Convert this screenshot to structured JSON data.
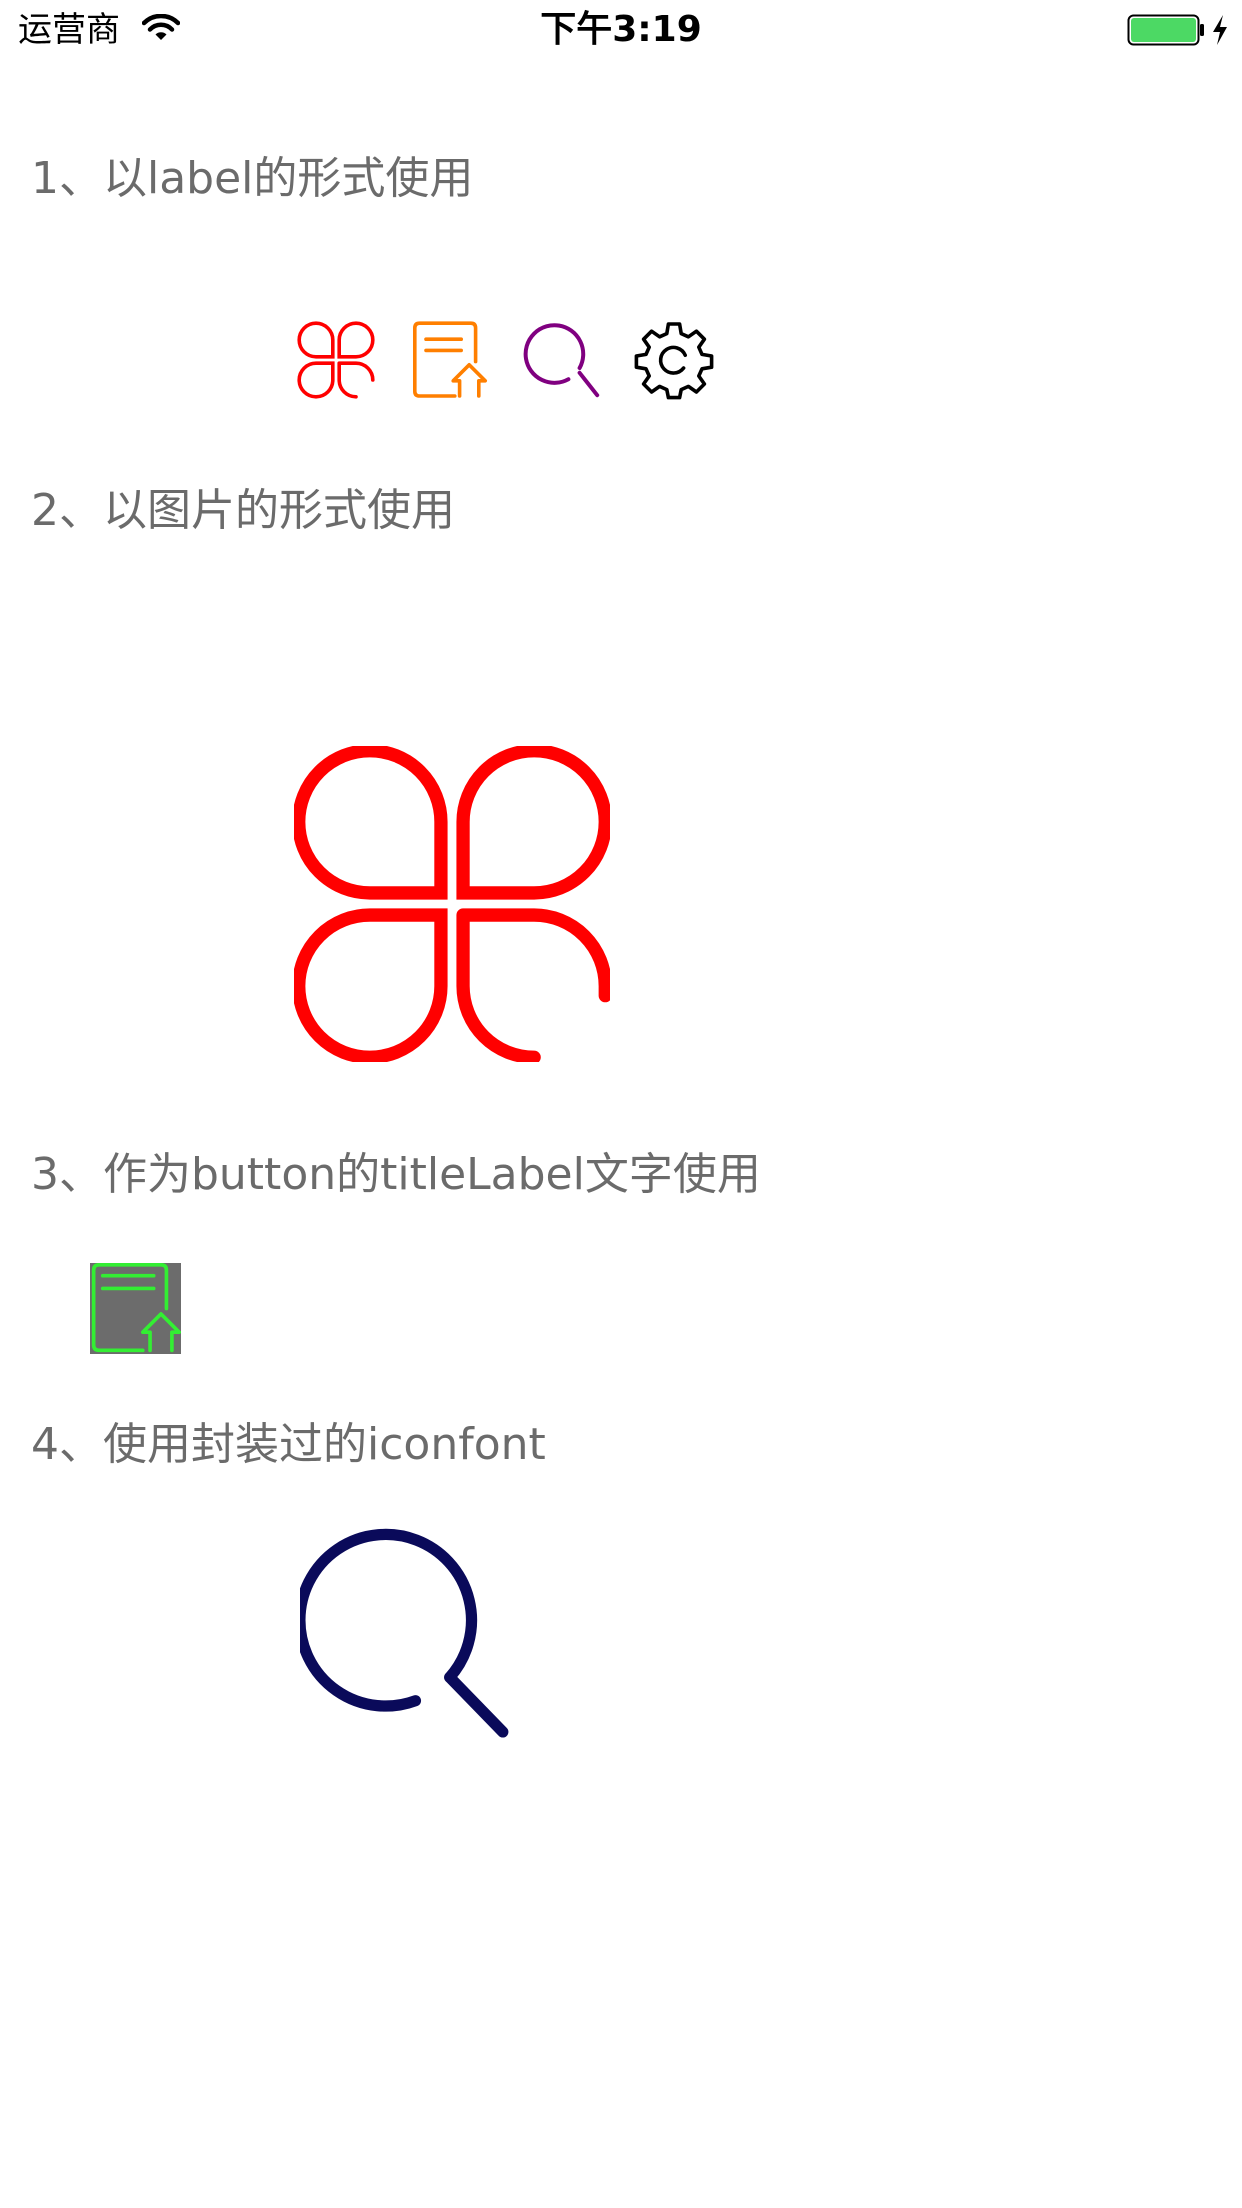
{
  "status_bar": {
    "carrier": "运营商",
    "time": "下午3:19",
    "wifi_icon": "wifi-icon",
    "battery_icon": "battery-icon",
    "charging_icon": "bolt-icon",
    "battery_color": "#4cd964"
  },
  "sections": {
    "label": {
      "title": "1、以label的形式使用",
      "icons": [
        {
          "name": "clover-icon",
          "color": "#ff0000"
        },
        {
          "name": "document-upload-icon",
          "color": "#ff7f00"
        },
        {
          "name": "search-icon",
          "color": "#800080"
        },
        {
          "name": "gear-icon",
          "color": "#000000"
        }
      ]
    },
    "image": {
      "title": "2、以图片的形式使用",
      "icon": {
        "name": "clover-icon",
        "color": "#ff0000"
      }
    },
    "button": {
      "title": "3、作为button的titleLabel文字使用",
      "icon": {
        "name": "document-upload-icon",
        "color": "#33ee33"
      },
      "background": "#6c6c6c"
    },
    "wrapped": {
      "title": "4、使用封装过的iconfont",
      "icon": {
        "name": "search-icon",
        "color": "#0a0a5a"
      }
    }
  }
}
